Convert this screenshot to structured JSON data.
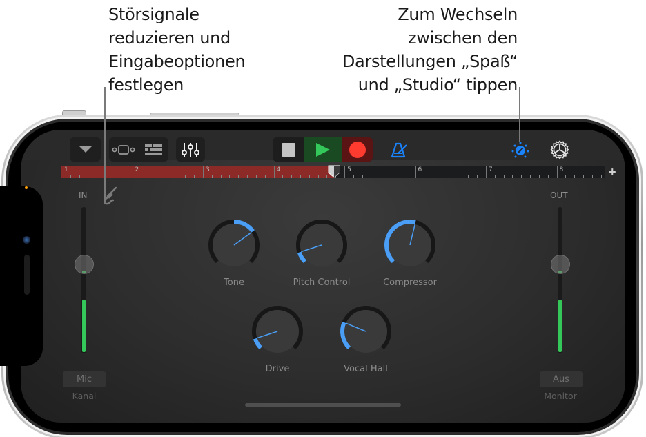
{
  "callouts": {
    "left": {
      "lines": [
        "Störsignale",
        "reduzieren und",
        "Eingabeoptionen",
        "festlegen"
      ]
    },
    "right": {
      "lines": [
        "Zum Wechseln",
        "zwischen den",
        "Darstellungen „Spaß“",
        "und „Studio“ tippen"
      ]
    }
  },
  "toolbar": {
    "browser_icon": "triangle-down-icon",
    "tracks_view_icon": "tracks-view-icon",
    "editor_icon": "editor-list-icon",
    "mixer_icon": "mixer-sliders-icon",
    "stop_icon": "stop-icon",
    "play_icon": "play-icon",
    "record_icon": "record-icon",
    "metronome_icon": "metronome-icon",
    "view_toggle_icon": "knob-view-icon",
    "settings_icon": "gear-icon",
    "add_section_label": "+"
  },
  "colors": {
    "accent_blue": "#1a82fb",
    "play_green": "#34c759",
    "record_red": "#ff3b30",
    "ruler_red": "#8b2a27",
    "meter_green": "#34c759"
  },
  "ruler": {
    "bars": [
      "1",
      "2",
      "3",
      "4",
      "5",
      "6",
      "7",
      "8"
    ],
    "region_end_bar": 4.85,
    "playhead_bar": 4.85
  },
  "input": {
    "label": "IN",
    "noise_gate_icon": "input-jack-icon",
    "level": 0.36,
    "meter_level": 0.36,
    "channel_button": "Mic",
    "channel_label": "Kanal"
  },
  "output": {
    "label": "OUT",
    "level": 0.36,
    "meter_level": 0.36,
    "monitor_button": "Aus",
    "monitor_label": "Monitor"
  },
  "knobs": [
    {
      "label": "Tone",
      "value": 0.7
    },
    {
      "label": "Pitch Control",
      "value": 0.1
    },
    {
      "label": "Compressor",
      "value": 0.55
    },
    {
      "label": "Drive",
      "value": 0.1
    },
    {
      "label": "Vocal Hall",
      "value": 0.25
    }
  ]
}
